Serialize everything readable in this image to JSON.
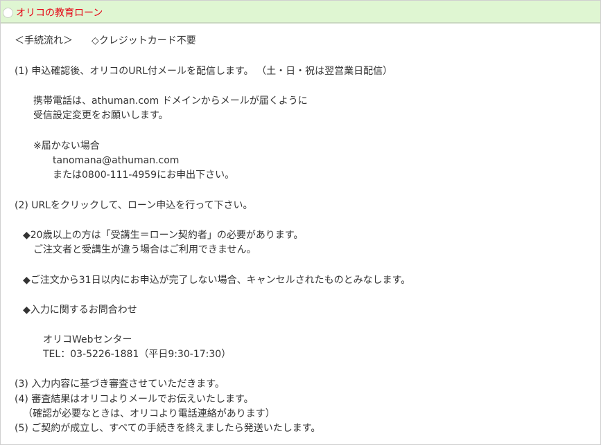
{
  "header": {
    "title": "オリコの教育ローン"
  },
  "colors": {
    "header_bg": "#dff6d2",
    "title_text": "#e60012",
    "body_text": "#333333"
  },
  "content": {
    "flow_heading": "＜手続流れ＞",
    "no_card_note": "◇クレジットカード不要",
    "step1": "(1) 申込確認後、オリコのURL付メールを配信します。 （土・日・祝は翌営業日配信）",
    "step1_mobile_1": "携帯電話は、athuman.com ドメインからメールが届くように",
    "step1_mobile_2": "受信設定変更をお願いします。",
    "step1_notreceived": "※届かない場合",
    "step1_email": "tanomana@athuman.com",
    "step1_phone": "または0800-111-4959にお申出下さい。",
    "step2": "(2) URLをクリックして、ローン申込を行って下さい。",
    "note_age_1": "◆20歳以上の方は「受講生＝ローン契約者」の必要があります。",
    "note_age_2": "ご注文者と受講生が違う場合はご利用できません。",
    "note_31days": "◆ご注文から31日以内にお申込が完了しない場合、キャンセルされたものとみなします。",
    "note_inquiry": "◆入力に関するお問合わせ",
    "inquiry_center": "オリコWebセンター",
    "inquiry_tel": "TEL：03-5226-1881（平日9:30-17:30）",
    "step3": "(3) 入力内容に基づき審査させていただきます。",
    "step4": "(4) 審査結果はオリコよりメールでお伝えいたします。",
    "step4_note": "（確認が必要なときは、オリコより電話連絡があります）",
    "step5": "(5) ご契約が成立し、すべての手続きを終えましたら発送いたします。"
  }
}
